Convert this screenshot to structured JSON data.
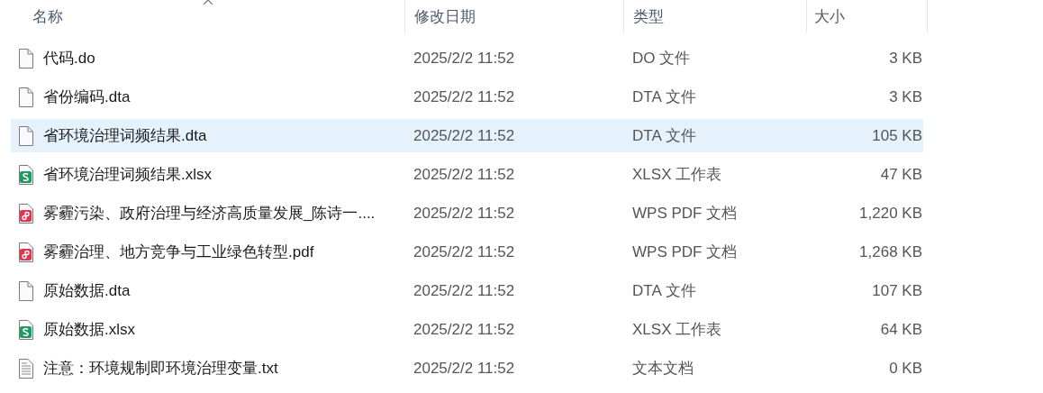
{
  "columns": [
    {
      "label": "名称",
      "sorted": true
    },
    {
      "label": "修改日期",
      "sorted": false
    },
    {
      "label": "类型",
      "sorted": false
    },
    {
      "label": "大小",
      "sorted": false
    }
  ],
  "files": [
    {
      "kind": "blank",
      "name": "代码.do",
      "modified": "2025/2/2 11:52",
      "type": "DO 文件",
      "size": "3 KB",
      "selected": false
    },
    {
      "kind": "blank",
      "name": "省份编码.dta",
      "modified": "2025/2/2 11:52",
      "type": "DTA 文件",
      "size": "3 KB",
      "selected": false
    },
    {
      "kind": "blank",
      "name": "省环境治理词频结果.dta",
      "modified": "2025/2/2 11:52",
      "type": "DTA 文件",
      "size": "105 KB",
      "selected": true
    },
    {
      "kind": "sheet",
      "name": "省环境治理词频结果.xlsx",
      "modified": "2025/2/2 11:52",
      "type": "XLSX 工作表",
      "size": "47 KB",
      "selected": false
    },
    {
      "kind": "pdf",
      "name": "雾霾污染、政府治理与经济高质量发展_陈诗一....",
      "modified": "2025/2/2 11:52",
      "type": "WPS PDF 文档",
      "size": "1,220 KB",
      "selected": false
    },
    {
      "kind": "pdf",
      "name": "雾霾治理、地方竞争与工业绿色转型.pdf",
      "modified": "2025/2/2 11:52",
      "type": "WPS PDF 文档",
      "size": "1,268 KB",
      "selected": false
    },
    {
      "kind": "blank",
      "name": "原始数据.dta",
      "modified": "2025/2/2 11:52",
      "type": "DTA 文件",
      "size": "107 KB",
      "selected": false
    },
    {
      "kind": "sheet",
      "name": "原始数据.xlsx",
      "modified": "2025/2/2 11:52",
      "type": "XLSX 工作表",
      "size": "64 KB",
      "selected": false
    },
    {
      "kind": "text",
      "name": "注意：环境规制即环境治理变量.txt",
      "modified": "2025/2/2 11:52",
      "type": "文本文档",
      "size": "0 KB",
      "selected": false
    }
  ]
}
